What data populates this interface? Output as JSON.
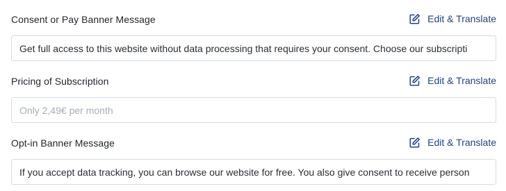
{
  "fields": [
    {
      "label": "Consent or Pay Banner Message",
      "action_label": "Edit & Translate",
      "value": "Get full access to this website without data processing that requires your consent. Choose our subscripti",
      "placeholder": ""
    },
    {
      "label": "Pricing of Subscription",
      "action_label": "Edit & Translate",
      "value": "",
      "placeholder": "Only 2,49€ per month"
    },
    {
      "label": "Opt-in Banner Message",
      "action_label": "Edit & Translate",
      "value": "If you accept data tracking, you can browse our website for free. You also give consent to receive person",
      "placeholder": ""
    }
  ],
  "icons": {
    "edit": "edit-square-icon"
  },
  "colors": {
    "link": "#24437e",
    "border": "#d6dbe1",
    "placeholder": "#a6adb6"
  }
}
